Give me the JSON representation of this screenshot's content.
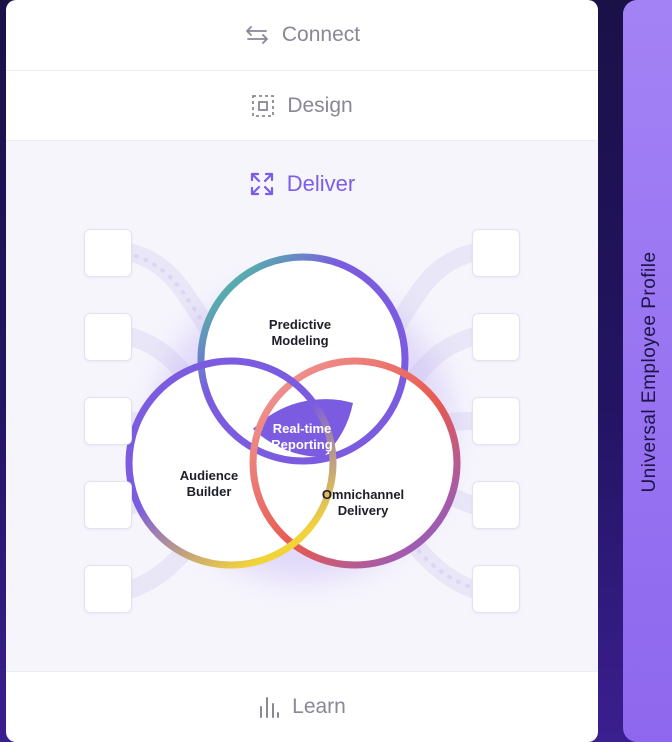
{
  "nav": {
    "connect": {
      "label": "Connect",
      "icon": "swap-arrows-icon"
    },
    "design": {
      "label": "Design",
      "icon": "frame-select-icon"
    },
    "deliver": {
      "label": "Deliver",
      "icon": "expand-arrows-icon",
      "active": true
    },
    "learn": {
      "label": "Learn",
      "icon": "bar-chart-icon"
    }
  },
  "venn": {
    "top": {
      "line1": "Predictive",
      "line2": "Modeling"
    },
    "left": {
      "line1": "Audience",
      "line2": "Builder"
    },
    "right": {
      "line1": "Omnichannel",
      "line2": "Delivery"
    },
    "center": {
      "line1": "Real-time",
      "line2": "Reporting"
    }
  },
  "sidebar": {
    "label": "Universal Employee Profile"
  },
  "colors": {
    "accent": "#7c5ee6",
    "ring_purple": "#7b5ce0",
    "ring_green": "#3ee38a",
    "ring_red": "#e85a4f",
    "ring_yellow": "#f3d33a",
    "side_bar": "#9a78f2"
  }
}
